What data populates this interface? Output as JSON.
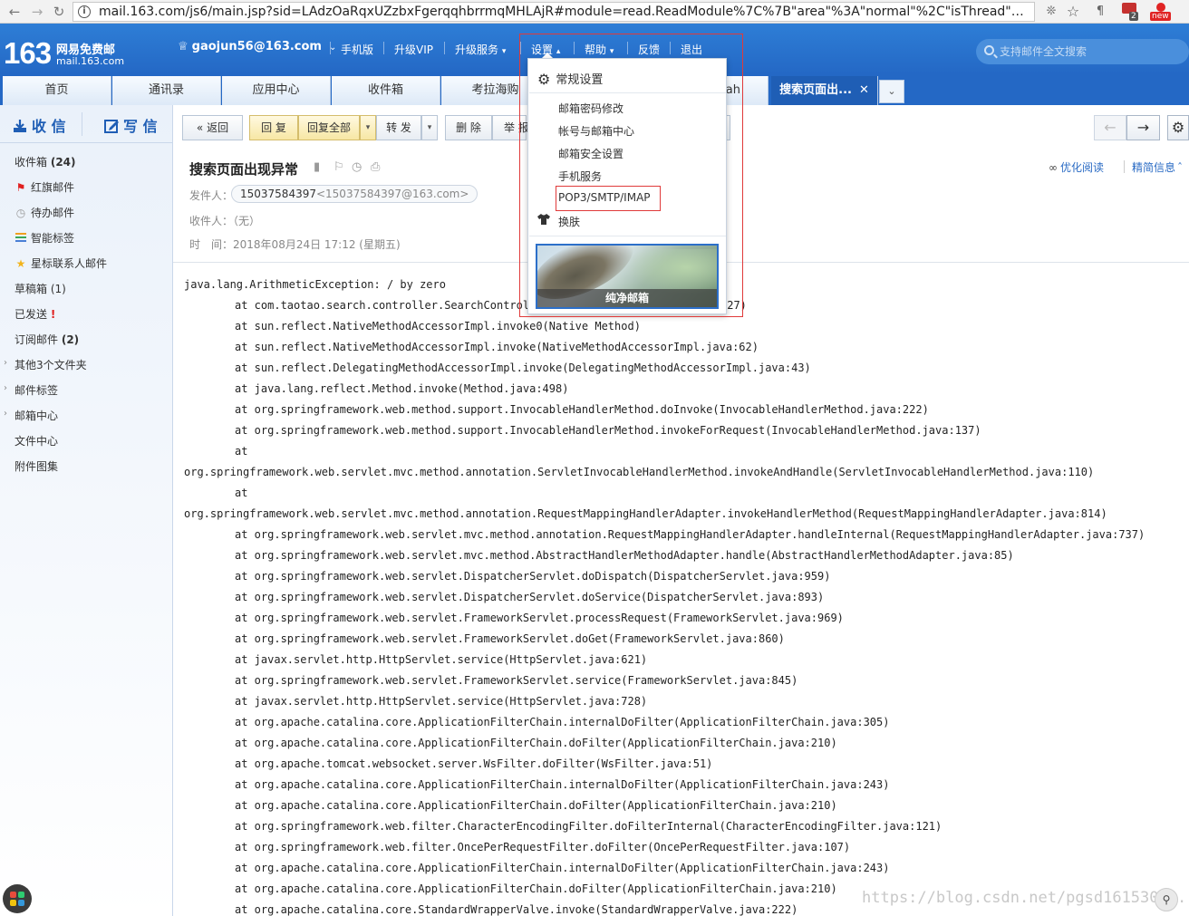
{
  "browser": {
    "url": "mail.163.com/js6/main.jsp?sid=LAdzOaRqxUZzbxFgerqqhbrrmqMHLAjR#module=read.ReadModule%7C%7B\"area\"%3A\"normal\"%2C\"isThread\"%3Afals...",
    "abp_badge": "2",
    "new_badge": "new"
  },
  "header": {
    "logo_number": "163",
    "logo_text_cn": "网易免费邮",
    "logo_text_en": "mail.163.com",
    "user_email": "gaojun56@163.com",
    "nav": {
      "mobile": "手机版",
      "vip": "升级VIP",
      "upgrade": "升级服务",
      "settings": "设置",
      "help": "帮助",
      "feedback": "反馈",
      "logout": "退出"
    },
    "search_placeholder": "支持邮件全文搜索"
  },
  "tabs": [
    "首页",
    "通讯录",
    "应用中心",
    "收件箱",
    "考拉海购"
  ],
  "tab_hidden_fragment": "ah",
  "active_tab": "搜索页面出...",
  "sidebar": {
    "receive": "收 信",
    "write": "写 信",
    "inbox_label": "收件箱",
    "inbox_count": "(24)",
    "red_flag": "红旗邮件",
    "todo": "待办邮件",
    "smart_tags": "智能标签",
    "star_contacts": "星标联系人邮件",
    "drafts": "草稿箱 (1)",
    "sent": "已发送",
    "sent_mark": "!",
    "subscribed_label": "订阅邮件",
    "subscribed_count": "(2)",
    "other_folders": "其他3个文件夹",
    "mail_tags": "邮件标签",
    "mailbox_center": "邮箱中心",
    "file_center": "文件中心",
    "attachments": "附件图集"
  },
  "toolbar": {
    "back": "返回",
    "reply": "回 复",
    "reply_all": "回复全部",
    "forward": "转 发",
    "delete": "删 除",
    "report": "举 报",
    "dropdown_glyph": "▾"
  },
  "mail": {
    "subject": "搜索页面出现异常",
    "sender_label": "发件人：",
    "sender_name": "15037584397",
    "sender_addr": "<15037584397@163.com>",
    "recipient_label": "收件人：",
    "recipient_value": "（无）",
    "time_label": "时　间：",
    "time_value": "2018年08月24日 17:12 (星期五)",
    "read_mode": "优化阅读",
    "brief_info": "精简信息"
  },
  "stack_trace": [
    {
      "text": "java.lang.ArithmeticException: / by zero",
      "indent": false
    },
    {
      "text": "at com.taotao.search.controller.SearchControll",
      "tail": ":27)",
      "indent": true
    },
    {
      "text": "at sun.reflect.NativeMethodAccessorImpl.invoke0(Native Method)",
      "indent": true
    },
    {
      "text": "at sun.reflect.NativeMethodAccessorImpl.invoke(NativeMethodAccessorImpl.java:62)",
      "indent": true
    },
    {
      "text": "at sun.reflect.DelegatingMethodAccessorImpl.invoke(DelegatingMethodAccessorImpl.java:43)",
      "indent": true
    },
    {
      "text": "at java.lang.reflect.Method.invoke(Method.java:498)",
      "indent": true
    },
    {
      "text": "at org.springframework.web.method.support.InvocableHandlerMethod.doInvoke(InvocableHandlerMethod.java:222)",
      "indent": true
    },
    {
      "text": "at org.springframework.web.method.support.InvocableHandlerMethod.invokeForRequest(InvocableHandlerMethod.java:137)",
      "indent": true
    },
    {
      "text": "at",
      "indent": true
    },
    {
      "text": "org.springframework.web.servlet.mvc.method.annotation.ServletInvocableHandlerMethod.invokeAndHandle(ServletInvocableHandlerMethod.java:110)",
      "indent": false
    },
    {
      "text": "at",
      "indent": true
    },
    {
      "text": "org.springframework.web.servlet.mvc.method.annotation.RequestMappingHandlerAdapter.invokeHandlerMethod(RequestMappingHandlerAdapter.java:814)",
      "indent": false
    },
    {
      "text": "at org.springframework.web.servlet.mvc.method.annotation.RequestMappingHandlerAdapter.handleInternal(RequestMappingHandlerAdapter.java:737)",
      "indent": true
    },
    {
      "text": "at org.springframework.web.servlet.mvc.method.AbstractHandlerMethodAdapter.handle(AbstractHandlerMethodAdapter.java:85)",
      "indent": true
    },
    {
      "text": "at org.springframework.web.servlet.DispatcherServlet.doDispatch(DispatcherServlet.java:959)",
      "indent": true
    },
    {
      "text": "at org.springframework.web.servlet.DispatcherServlet.doService(DispatcherServlet.java:893)",
      "indent": true
    },
    {
      "text": "at org.springframework.web.servlet.FrameworkServlet.processRequest(FrameworkServlet.java:969)",
      "indent": true
    },
    {
      "text": "at org.springframework.web.servlet.FrameworkServlet.doGet(FrameworkServlet.java:860)",
      "indent": true
    },
    {
      "text": "at javax.servlet.http.HttpServlet.service(HttpServlet.java:621)",
      "indent": true
    },
    {
      "text": "at org.springframework.web.servlet.FrameworkServlet.service(FrameworkServlet.java:845)",
      "indent": true
    },
    {
      "text": "at javax.servlet.http.HttpServlet.service(HttpServlet.java:728)",
      "indent": true
    },
    {
      "text": "at org.apache.catalina.core.ApplicationFilterChain.internalDoFilter(ApplicationFilterChain.java:305)",
      "indent": true
    },
    {
      "text": "at org.apache.catalina.core.ApplicationFilterChain.doFilter(ApplicationFilterChain.java:210)",
      "indent": true
    },
    {
      "text": "at org.apache.tomcat.websocket.server.WsFilter.doFilter(WsFilter.java:51)",
      "indent": true
    },
    {
      "text": "at org.apache.catalina.core.ApplicationFilterChain.internalDoFilter(ApplicationFilterChain.java:243)",
      "indent": true
    },
    {
      "text": "at org.apache.catalina.core.ApplicationFilterChain.doFilter(ApplicationFilterChain.java:210)",
      "indent": true
    },
    {
      "text": "at org.springframework.web.filter.CharacterEncodingFilter.doFilterInternal(CharacterEncodingFilter.java:121)",
      "indent": true
    },
    {
      "text": "at org.springframework.web.filter.OncePerRequestFilter.doFilter(OncePerRequestFilter.java:107)",
      "indent": true
    },
    {
      "text": "at org.apache.catalina.core.ApplicationFilterChain.internalDoFilter(ApplicationFilterChain.java:243)",
      "indent": true
    },
    {
      "text": "at org.apache.catalina.core.ApplicationFilterChain.doFilter(ApplicationFilterChain.java:210)",
      "indent": true
    },
    {
      "text": "at org.apache.catalina.core.StandardWrapperValve.invoke(StandardWrapperValve.java:222)",
      "indent": true
    }
  ],
  "settings_menu": {
    "general": "常规设置",
    "password": "邮箱密码修改",
    "account_center": "帐号与邮箱中心",
    "security": "邮箱安全设置",
    "mobile_service": "手机服务",
    "pop3": "POP3/SMTP/IMAP",
    "skin": "换肤",
    "skin_thumbnail": "纯净邮箱"
  },
  "watermark": "https://blog.csdn.net/pgsd1615302..",
  "colors": {
    "brand_blue": "#2468c5",
    "highlight_red": "#e03a3a",
    "link_blue": "#2a6bc4"
  },
  "icons": [
    "back-icon",
    "forward-icon",
    "reload-icon",
    "info-icon",
    "extension-icon",
    "star-icon",
    "crown-icon",
    "search-icon",
    "inbox-icon",
    "pen-icon",
    "flag-icon",
    "clock-icon",
    "tag-icon",
    "star-icon",
    "bookmark-icon",
    "flag-outline-icon",
    "clock-outline-icon",
    "print-icon",
    "glasses-icon",
    "gear-icon",
    "shirt-icon",
    "apps-icon",
    "zoom-icon"
  ]
}
